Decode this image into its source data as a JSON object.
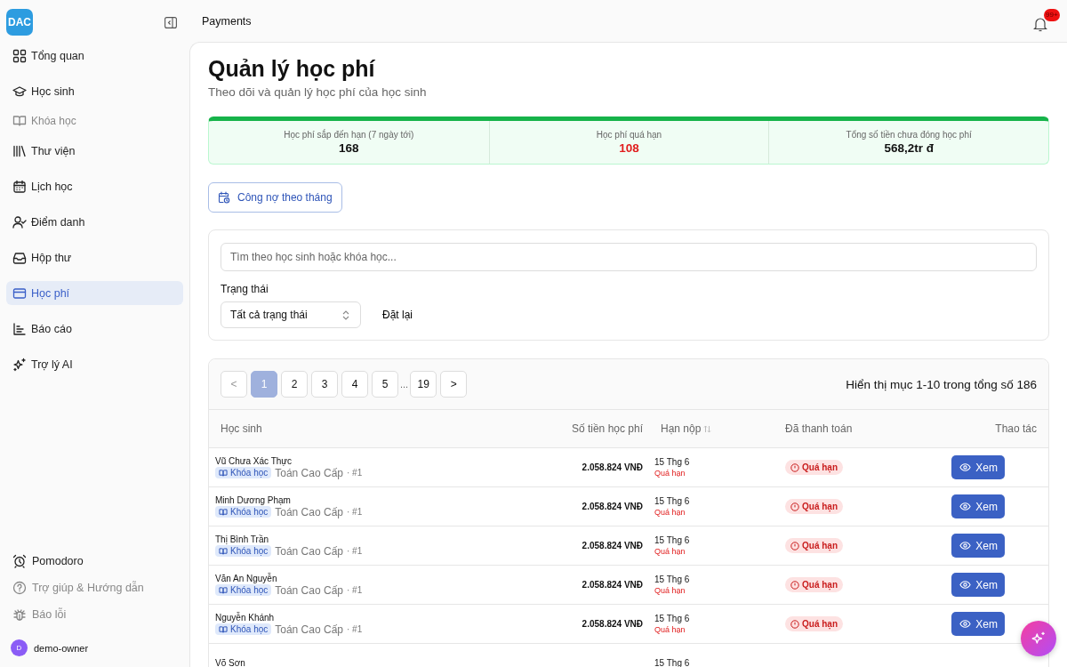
{
  "sidebar": {
    "logo": "DAC",
    "items": [
      {
        "label": "Tổng quan",
        "selected": false,
        "disabled": false
      },
      {
        "label": "Học sinh",
        "selected": false,
        "disabled": false
      },
      {
        "label": "Khóa học",
        "selected": false,
        "disabled": true
      },
      {
        "label": "Thư viện",
        "selected": false,
        "disabled": false
      },
      {
        "label": "Lịch học",
        "selected": false,
        "disabled": false
      },
      {
        "label": "Điểm danh",
        "selected": false,
        "disabled": false
      },
      {
        "label": "Hộp thư",
        "selected": false,
        "disabled": false
      },
      {
        "label": "Học phí",
        "selected": true,
        "disabled": false
      },
      {
        "label": "Báo cáo",
        "selected": false,
        "disabled": false
      },
      {
        "label": "Trợ lý AI",
        "selected": false,
        "disabled": false
      }
    ],
    "footer_items": [
      {
        "label": "Pomodoro",
        "disabled": false
      },
      {
        "label": "Trợ giúp & Hướng dẫn",
        "disabled": true
      },
      {
        "label": "Báo lỗi",
        "disabled": true
      }
    ],
    "user": {
      "initial": "D",
      "name": "demo-owner"
    }
  },
  "header": {
    "breadcrumb": "Payments",
    "notification_count": "99+"
  },
  "page": {
    "title": "Quản lý học phí",
    "subtitle": "Theo dõi và quản lý học phí của học sinh"
  },
  "stats": [
    {
      "label": "Học phí sắp đến hạn (7 ngày tới)",
      "value": "168",
      "alert": false
    },
    {
      "label": "Học phí quá hạn",
      "value": "108",
      "alert": true
    },
    {
      "label": "Tổng số tiền chưa đóng học phí",
      "value": "568,2tr đ",
      "alert": false
    }
  ],
  "monthly_button": "Công nợ theo tháng",
  "filters": {
    "search_placeholder": "Tìm theo học sinh hoặc khóa học...",
    "status_label": "Trạng thái",
    "status_value": "Tất cả trạng thái",
    "reset": "Đặt lại"
  },
  "pagination": {
    "prev": "<",
    "next": ">",
    "ellipsis": "...",
    "pages": [
      {
        "label": "1",
        "selected": true
      },
      {
        "label": "2",
        "selected": false
      },
      {
        "label": "3",
        "selected": false
      },
      {
        "label": "4",
        "selected": false
      },
      {
        "label": "5",
        "selected": false
      },
      {
        "label": "19",
        "selected": false
      }
    ],
    "summary": "Hiển thị mục 1-10 trong tổng số 186"
  },
  "table": {
    "columns": [
      "Học sinh",
      "Số tiền học phí",
      "Hạn nộp",
      "Đã thanh toán",
      "Thao tác"
    ],
    "rows": [
      {
        "student": "Vũ Chưa Xác Thực",
        "tag": "Khóa học",
        "course": "Toán Cao Cấp",
        "suffix": "· #1",
        "amount": "2.058.824 VNĐ",
        "due": "15 Thg 6",
        "due_status": "Quá hạn",
        "status": "Quá hạn",
        "action": "Xem"
      },
      {
        "student": "Minh Dương Phạm",
        "tag": "Khóa học",
        "course": "Toán Cao Cấp",
        "suffix": "· #1",
        "amount": "2.058.824 VNĐ",
        "due": "15 Thg 6",
        "due_status": "Quá hạn",
        "status": "Quá hạn",
        "action": "Xem"
      },
      {
        "student": "Thị Bình Trần",
        "tag": "Khóa học",
        "course": "Toán Cao Cấp",
        "suffix": "· #1",
        "amount": "2.058.824 VNĐ",
        "due": "15 Thg 6",
        "due_status": "Quá hạn",
        "status": "Quá hạn",
        "action": "Xem"
      },
      {
        "student": "Văn An Nguyễn",
        "tag": "Khóa học",
        "course": "Toán Cao Cấp",
        "suffix": "· #1",
        "amount": "2.058.824 VNĐ",
        "due": "15 Thg 6",
        "due_status": "Quá hạn",
        "status": "Quá hạn",
        "action": "Xem"
      },
      {
        "student": "Nguyễn Khánh",
        "tag": "Khóa học",
        "course": "Toán Cao Cấp",
        "suffix": "· #1",
        "amount": "2.058.824 VNĐ",
        "due": "15 Thg 6",
        "due_status": "Quá hạn",
        "status": "Quá hạn",
        "action": "Xem"
      },
      {
        "student": "Võ Sơn",
        "due": "15 Thg 6"
      }
    ]
  }
}
